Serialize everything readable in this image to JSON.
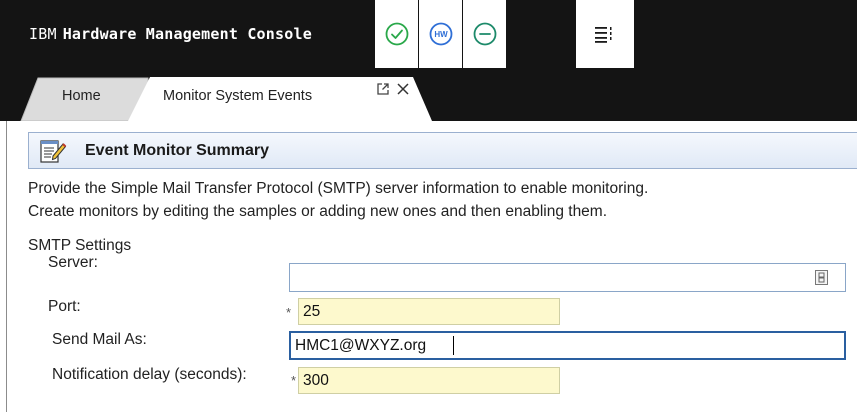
{
  "header": {
    "brand_ibm": "IBM",
    "brand_name": "Hardware Management Console",
    "status_icons": [
      "check-circle-icon",
      "hardware-hw-icon",
      "minus-circle-icon"
    ],
    "menu_icon": "task-menu-icon",
    "hw_text": "HW"
  },
  "tabs": [
    {
      "label": "Home",
      "active": false
    },
    {
      "label": "Monitor System Events",
      "active": true
    }
  ],
  "tab_actions": {
    "popout_icon": "popout-icon",
    "close_icon": "close-icon"
  },
  "summary": {
    "title": "Event Monitor Summary",
    "icon": "notepad-edit-icon"
  },
  "description": {
    "line1": "Provide the Simple Mail Transfer Protocol (SMTP) server information to enable monitoring.",
    "line2": "Create monitors by editing the samples or adding new ones and then enabling them."
  },
  "smtp": {
    "section_title": "SMTP Settings",
    "server": {
      "label": "Server:",
      "value": ""
    },
    "port": {
      "label": "Port:",
      "value": "25",
      "required": "*"
    },
    "send_mail_as": {
      "label": "Send Mail As:",
      "value": "HMC1@WXYZ.org"
    },
    "notification_delay": {
      "label": "Notification delay (seconds):",
      "value": "300",
      "required": "*"
    }
  },
  "colors": {
    "header_bg": "#141414",
    "tile_green": "#2aa84a",
    "tile_blue": "#2f6fd6",
    "tile_teal": "#1d8a6a",
    "summary_bg": "#e0e9f6",
    "required_field_bg": "#fdf9cd",
    "focus_border": "#2a5fa0"
  }
}
